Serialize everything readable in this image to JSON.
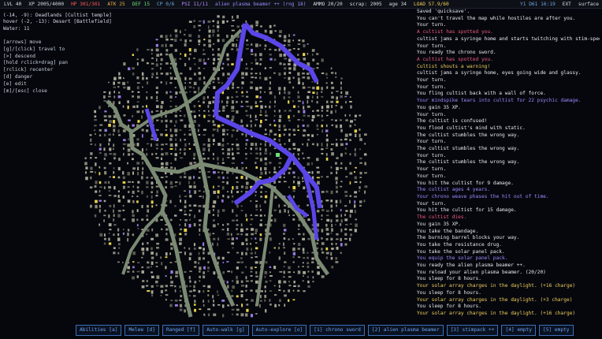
{
  "topbar": {
    "stats": [
      {
        "text": "LVL 40",
        "color": "#d7dde6"
      },
      {
        "text": "XP 2005/4000",
        "color": "#d7dde6"
      },
      {
        "text": "HP 301/301",
        "color": "#ff5b5b"
      },
      {
        "text": "ATK 25",
        "color": "#f0b048"
      },
      {
        "text": "DEF 15",
        "color": "#6be07a"
      },
      {
        "text": "CP 0/6",
        "color": "#6fa3e8"
      },
      {
        "text": "PSI 11/11",
        "color": "#b18bff"
      },
      {
        "text": "alien plasma beamer ++ (rng 18)",
        "color": "#9b8bff"
      },
      {
        "text": "AMMO 20/20",
        "color": "#d7dde6"
      },
      {
        "text": "scrap: 2005",
        "color": "#d7dde6"
      },
      {
        "text": "age 34",
        "color": "#d7dde6"
      },
      {
        "text": "LOAD 57.9/60",
        "color": "#f2cf5a"
      }
    ],
    "right": [
      {
        "text": "Y1 D61 16:19",
        "color": "#6fa3e8"
      },
      {
        "text": "EXT",
        "color": "#d7dde6"
      },
      {
        "text": "surface",
        "color": "#d7dde6"
      }
    ]
  },
  "info": {
    "coords": "(-14, -9): Deadlands [Cultist temple]",
    "hover": "hover (-2, -13): Desert [Battlefield]",
    "water": "Water: 11"
  },
  "help": [
    "[arrows] move",
    "[g]/[click] travel to",
    "[>] descend",
    "[hold rclick+drag] pan",
    "[rclick] recenter",
    "[d] danger",
    "[e] edit",
    "[m]/[esc] close"
  ],
  "log": [
    {
      "text": "Saved 'quicksave'.",
      "c": "lw"
    },
    {
      "text": "You can't travel the map while hostiles are after you.",
      "c": "lw"
    },
    {
      "text": "Your turn.",
      "c": "lw"
    },
    {
      "text": "A cultist has spotted you.",
      "c": "lr"
    },
    {
      "text": "cultist jams a syringe home and starts twitching with stim-speed.",
      "c": "lw"
    },
    {
      "text": "Your turn.",
      "c": "lw"
    },
    {
      "text": "You ready the chrono sword.",
      "c": "lw"
    },
    {
      "text": "A cultist has spotted you.",
      "c": "lr"
    },
    {
      "text": "Cultist shouts a warning!",
      "c": "ly"
    },
    {
      "text": "cultist jams a syringe home, eyes going wide and glassy.",
      "c": "lw"
    },
    {
      "text": "Your turn.",
      "c": "lw"
    },
    {
      "text": "Your turn.",
      "c": "lw"
    },
    {
      "text": "You fling cultist back with a wall of force.",
      "c": "lw"
    },
    {
      "text": "Your mindspike tears into cultist for 22 psychic damage.",
      "c": "lb"
    },
    {
      "text": "You gain 35 XP.",
      "c": "lw"
    },
    {
      "text": "Your turn.",
      "c": "lw"
    },
    {
      "text": "The cultist is confused!",
      "c": "lw"
    },
    {
      "text": "You flood cultist's mind with static.",
      "c": "lw"
    },
    {
      "text": "The cultist stumbles the wrong way.",
      "c": "lw"
    },
    {
      "text": "Your turn.",
      "c": "lw"
    },
    {
      "text": "The cultist stumbles the wrong way.",
      "c": "lw"
    },
    {
      "text": "Your turn.",
      "c": "lw"
    },
    {
      "text": "The cultist stumbles the wrong way.",
      "c": "lw"
    },
    {
      "text": "Your turn.",
      "c": "lw"
    },
    {
      "text": "Your turn.",
      "c": "lw"
    },
    {
      "text": "You hit the cultist for 9 damage.",
      "c": "lw"
    },
    {
      "text": "The cultist ages 4 years.",
      "c": "lb"
    },
    {
      "text": "Your chrono weave phases the hit out of time.",
      "c": "lb"
    },
    {
      "text": "Your turn.",
      "c": "lw"
    },
    {
      "text": "You hit the cultist for 15 damage.",
      "c": "lw"
    },
    {
      "text": "The cultist dies.",
      "c": "lr"
    },
    {
      "text": "You gain 35 XP.",
      "c": "lw"
    },
    {
      "text": "You take the bandage.",
      "c": "lw"
    },
    {
      "text": "The burning barrel blocks your way.",
      "c": "lw"
    },
    {
      "text": "You take the resistance drug.",
      "c": "lw"
    },
    {
      "text": "You take the solar panel pack.",
      "c": "lw"
    },
    {
      "text": "You equip the solar panel pack.",
      "c": "lb"
    },
    {
      "text": "You ready the alien plasma beamer ++.",
      "c": "lw"
    },
    {
      "text": "You reload your alien plasma beamer. (20/20)",
      "c": "lw"
    },
    {
      "text": "You sleep for 8 hours.",
      "c": "lw"
    },
    {
      "text": "Your solar array charges in the daylight. (+16 charge)",
      "c": "ly"
    },
    {
      "text": "You sleep for 8 hours.",
      "c": "lw"
    },
    {
      "text": "Your solar array charges in the daylight. (+3 charge)",
      "c": "ly"
    },
    {
      "text": "You sleep for 8 hours.",
      "c": "lw"
    },
    {
      "text": "Your solar array charges in the daylight. (+16 charge)",
      "c": "ly"
    }
  ],
  "bottombar": {
    "buttons": [
      {
        "label": "Abilities [a]",
        "name": "abilities-button"
      },
      {
        "label": "Melee [d]",
        "name": "melee-button"
      },
      {
        "label": "Ranged [f]",
        "name": "ranged-button"
      },
      {
        "label": "Auto-walk [g]",
        "name": "auto-walk-button"
      },
      {
        "label": "Auto-explore [o]",
        "name": "auto-explore-button"
      },
      {
        "label": "[1] chrono sword",
        "name": "hotbar-slot-1-button"
      },
      {
        "label": "[2] alien plasma beamer",
        "name": "hotbar-slot-2-button"
      },
      {
        "label": "[3] stimpack ++",
        "name": "hotbar-slot-3-button"
      },
      {
        "label": "[4] empty",
        "name": "hotbar-slot-4-button"
      },
      {
        "label": "[5] empty",
        "name": "hotbar-slot-5-button"
      }
    ]
  },
  "map_colors": {
    "background": "#05070d",
    "terrain": "#8c8a7a",
    "road": "#7b8a73",
    "river": "#5a46e8",
    "highlight": "#e8d24a",
    "player": "#6be07a"
  }
}
